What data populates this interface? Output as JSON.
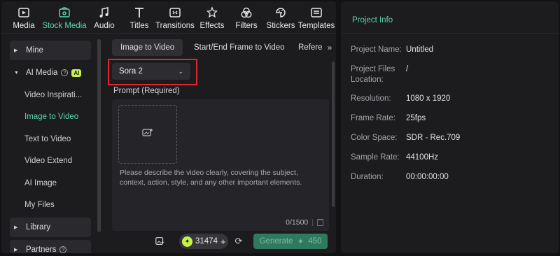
{
  "toolbar": {
    "items": [
      {
        "label": "Media",
        "icon": "media-icon"
      },
      {
        "label": "Stock Media",
        "icon": "stock-media-icon"
      },
      {
        "label": "Audio",
        "icon": "audio-icon"
      },
      {
        "label": "Titles",
        "icon": "titles-icon"
      },
      {
        "label": "Transitions",
        "icon": "transitions-icon"
      },
      {
        "label": "Effects",
        "icon": "effects-icon"
      },
      {
        "label": "Filters",
        "icon": "filters-icon"
      },
      {
        "label": "Stickers",
        "icon": "stickers-icon"
      },
      {
        "label": "Templates",
        "icon": "templates-icon"
      }
    ],
    "active": "Stock Media"
  },
  "sidebar": {
    "mine": "Mine",
    "ai_media": "AI Media",
    "ai_badge": "AI",
    "items": [
      {
        "label": "Video Inspirati..."
      },
      {
        "label": "Image to Video"
      },
      {
        "label": "Text to Video"
      },
      {
        "label": "Video Extend"
      },
      {
        "label": "AI Image"
      },
      {
        "label": "My Files"
      }
    ],
    "library": "Library",
    "partners": "Partners"
  },
  "main": {
    "tabs": [
      {
        "label": "Image to Video"
      },
      {
        "label": "Start/End Frame to Video"
      },
      {
        "label": "Referen"
      }
    ],
    "model": "Sora 2",
    "prompt_label": "Prompt (Required)",
    "prompt_placeholder": "Please describe the video clearly, covering the subject, context, action, style, and any other important elements.",
    "counter": "0/1500",
    "credits": "31474",
    "generate_label": "Generate",
    "generate_cost": "450"
  },
  "project_info": {
    "title": "Project Info",
    "rows": [
      {
        "key": "Project Name:",
        "value": "Untitled"
      },
      {
        "key": "Project Files Location:",
        "value": "/"
      },
      {
        "key": "Resolution:",
        "value": "1080 x 1920"
      },
      {
        "key": "Frame Rate:",
        "value": "25fps"
      },
      {
        "key": "Color Space:",
        "value": "SDR - Rec.709"
      },
      {
        "key": "Sample Rate:",
        "value": "44100Hz"
      },
      {
        "key": "Duration:",
        "value": "00:00:00:00"
      }
    ]
  },
  "colors": {
    "accent": "#58d6a8",
    "highlight": "#e0262f",
    "ai_badge": "#c6f24c",
    "generate": "#2f7a5f"
  }
}
